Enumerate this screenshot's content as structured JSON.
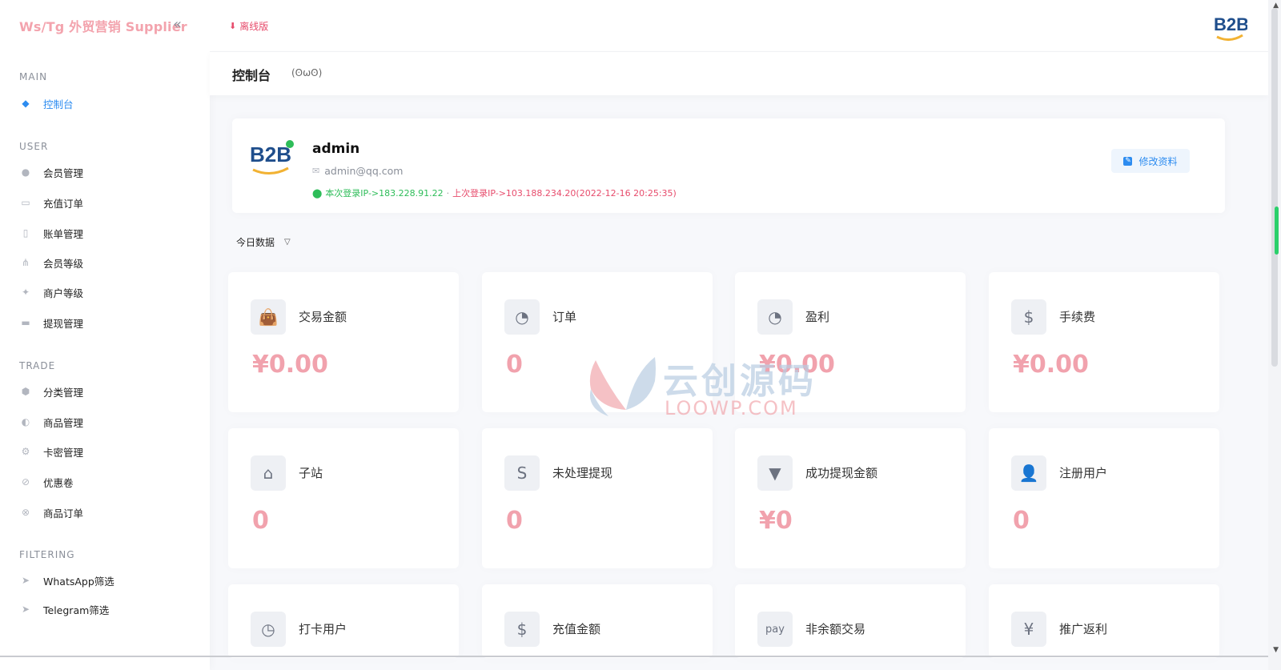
{
  "sidebar": {
    "brand": "Ws/Tg 外贸营销 Supplier",
    "collapse_icon": "«",
    "sections": {
      "main": "MAIN",
      "user": "USER",
      "trade": "TRADE",
      "filtering": "FILTERING"
    },
    "items": {
      "dashboard": "控制台",
      "members": "会员管理",
      "recharge_orders": "充值订单",
      "bills": "账单管理",
      "member_levels": "会员等级",
      "merchant_levels": "商户等级",
      "withdrawals": "提现管理",
      "categories": "分类管理",
      "products": "商品管理",
      "card_codes": "卡密管理",
      "coupons": "优惠卷",
      "product_orders": "商品订单",
      "whatsapp_filter": "WhatsApp筛选",
      "telegram_filter": "Telegram筛选"
    }
  },
  "header": {
    "offline_label": "离线版",
    "logo_text": "B2B"
  },
  "breadcrumb": {
    "title": "控制台",
    "subtitle": "(ʘωʘ)"
  },
  "profile": {
    "avatar_text": "B2B",
    "username": "admin",
    "email": "admin@qq.com",
    "current_login": "本次登录IP->183.228.91.22",
    "separator": "·",
    "last_login": "上次登录IP->103.188.234.20(2022-12-16 20:25:35)",
    "edit_button": "修改资料"
  },
  "filter": {
    "selected": "今日数据"
  },
  "stats": {
    "trade_amount": {
      "label": "交易金额",
      "value": "¥0.00"
    },
    "orders": {
      "label": "订单",
      "value": "0"
    },
    "profit": {
      "label": "盈利",
      "value": "¥0.00"
    },
    "fees": {
      "label": "手续费",
      "value": "¥0.00"
    },
    "substations": {
      "label": "子站",
      "value": "0"
    },
    "pending_withdrawals": {
      "label": "未处理提现",
      "value": "0"
    },
    "withdrawn_amount": {
      "label": "成功提现金额",
      "value": "¥0"
    },
    "registered_users": {
      "label": "注册用户",
      "value": "0"
    },
    "checkin_users": {
      "label": "打卡用户"
    },
    "recharge_amount": {
      "label": "充值金额"
    },
    "non_balance_trades": {
      "label": "非余额交易"
    },
    "referral_rebate": {
      "label": "推广返利"
    }
  },
  "watermark": {
    "text": "云创源码",
    "sub": "LOOWP.COM"
  },
  "colors": {
    "accent": "#2d8cf0",
    "value_pink": "#f1a2ad",
    "brand_pink": "#f3a3ad",
    "success_green": "#2ebd59",
    "danger_red": "#e74c6c"
  }
}
